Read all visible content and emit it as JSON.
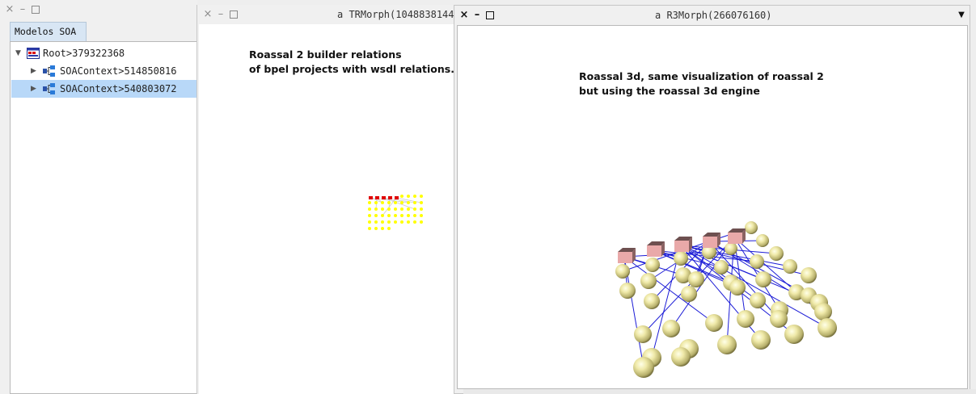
{
  "left_window": {
    "tab_label": "Modelos SOA",
    "tree": [
      {
        "label": "Root>379322368",
        "expanded": true,
        "icon": "root-model-icon"
      },
      {
        "label": "SOAContext>514850816",
        "expanded": false,
        "icon": "soa-context-icon"
      },
      {
        "label": "SOAContext>540803072",
        "expanded": false,
        "icon": "soa-context-icon",
        "selected": true
      }
    ]
  },
  "tr_window": {
    "title": "a TRMorph(1048838144",
    "note_line1": "Roassal 2  builder relations",
    "note_line2": "of bpel projects with wsdl relations."
  },
  "r3_window": {
    "title": "a R3Morph(266076160)",
    "menu_icon": "triangle-down-icon",
    "note_line1": "Roassal 3d, same visualization of roassal 2",
    "note_line2": "but using the roassal 3d engine"
  },
  "colors": {
    "selection": "#b8d8f8",
    "node_yellow": "#ffff00",
    "node_red": "#e00000",
    "edge_blue": "#1c1cd6",
    "sphere": "#e8e4a0",
    "cube": "#e9a9a9"
  }
}
